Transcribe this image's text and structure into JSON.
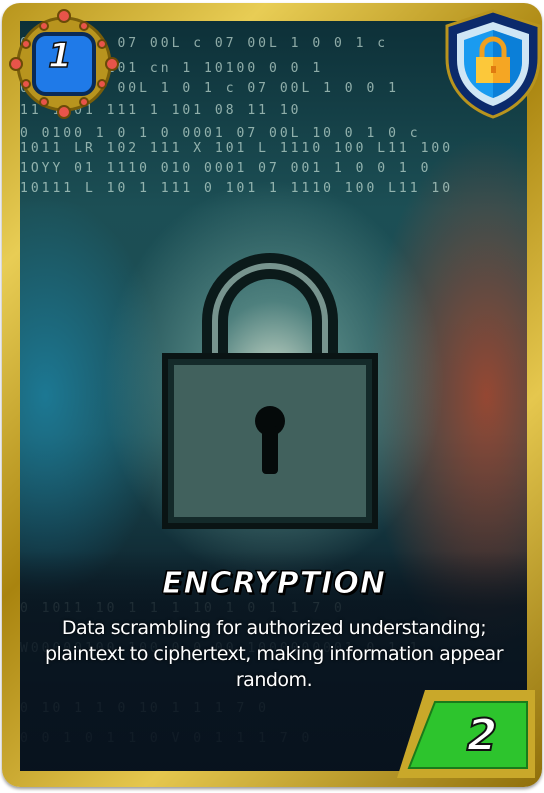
{
  "card": {
    "name": "ENCRYPTION",
    "description": "Data scrambling for authorized understanding; plaintext to ciphertext, making information appear random.",
    "cost": "1",
    "power": "2",
    "type_icon": "shield-lock-icon",
    "colors": {
      "frame": "#c9a82a",
      "cost_badge": "#1f7ae8",
      "power_box": "#2dc42d",
      "shield": "#0b5fd6"
    }
  }
}
